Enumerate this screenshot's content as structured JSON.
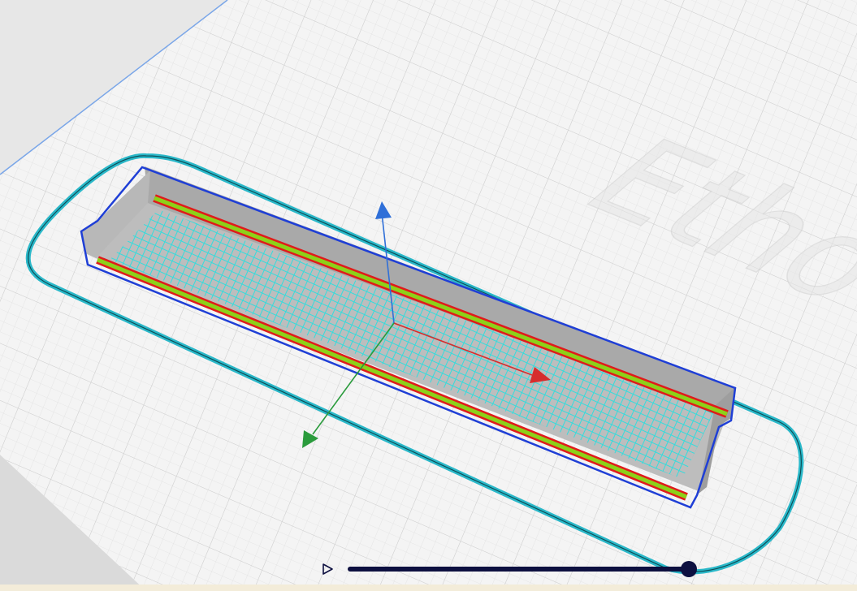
{
  "viewport": {
    "build_plate_color": "#f3f3f3",
    "grid_color": "#d9d9d9",
    "background_text": "Etho",
    "model": {
      "name": "",
      "wall_color": "#c9c9c9",
      "outline_color": "#1f3fd6",
      "infill_color": "#34dcdc",
      "perimeter_red": "#e01b1b",
      "perimeter_green": "#8cd119",
      "skirt_color": "#2ab8c9"
    },
    "gizmo": {
      "x_axis": "x-arrow",
      "y_axis": "y-arrow",
      "z_axis": "z-arrow",
      "x_color": "#d62d2d",
      "y_color": "#2a9b3c",
      "z_color": "#2f6fd8"
    }
  },
  "layer_slider": {
    "play_icon": "play-icon",
    "value": 1.0,
    "track_color": "#0d1040",
    "handle_color": "#0d1040"
  }
}
